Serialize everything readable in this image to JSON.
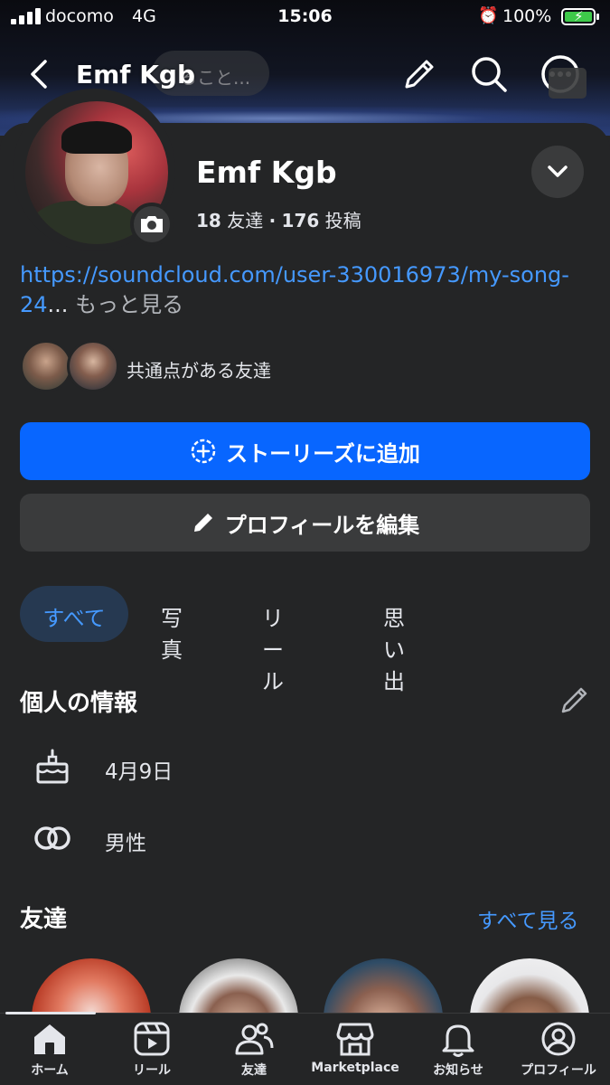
{
  "status_bar": {
    "carrier": "docomo",
    "network": "4G",
    "time": "15:06",
    "battery_percent": "100%"
  },
  "nav": {
    "title": "Emf Kgb",
    "search_placeholder": "ること..."
  },
  "profile": {
    "name": "Emf Kgb",
    "friends_count": "18",
    "friends_label": "友達",
    "separator": "·",
    "posts_count": "176",
    "posts_label": "投稿",
    "bio_link": "https://soundcloud.com/user-330016973/my-song-24",
    "bio_ellipsis": "...",
    "bio_more": "もっと見る",
    "mutual_friends_label": "共通点がある友達"
  },
  "actions": {
    "add_story": "ストーリーズに追加",
    "edit_profile": "プロフィールを編集"
  },
  "tabs": [
    {
      "label": "すべて",
      "active": true
    },
    {
      "label": "写真",
      "active": false
    },
    {
      "label": "リール",
      "active": false
    },
    {
      "label": "思い出",
      "active": false
    }
  ],
  "personal_info": {
    "title": "個人の情報",
    "birthday": "4月9日",
    "gender": "男性"
  },
  "friends": {
    "title": "友達",
    "see_all": "すべて見る"
  },
  "tab_bar": [
    {
      "label": "ホーム",
      "icon": "home-icon",
      "active": true
    },
    {
      "label": "リール",
      "icon": "reels-icon",
      "active": false
    },
    {
      "label": "友達",
      "icon": "friends-icon",
      "active": false
    },
    {
      "label": "Marketplace",
      "icon": "marketplace-icon",
      "active": false
    },
    {
      "label": "お知らせ",
      "icon": "bell-icon",
      "active": false
    },
    {
      "label": "プロフィール",
      "icon": "profile-icon",
      "active": false
    }
  ],
  "colors": {
    "background": "#242526",
    "accent_blue": "#0866ff",
    "link_blue": "#4599ff",
    "secondary_button": "#3a3b3c"
  }
}
